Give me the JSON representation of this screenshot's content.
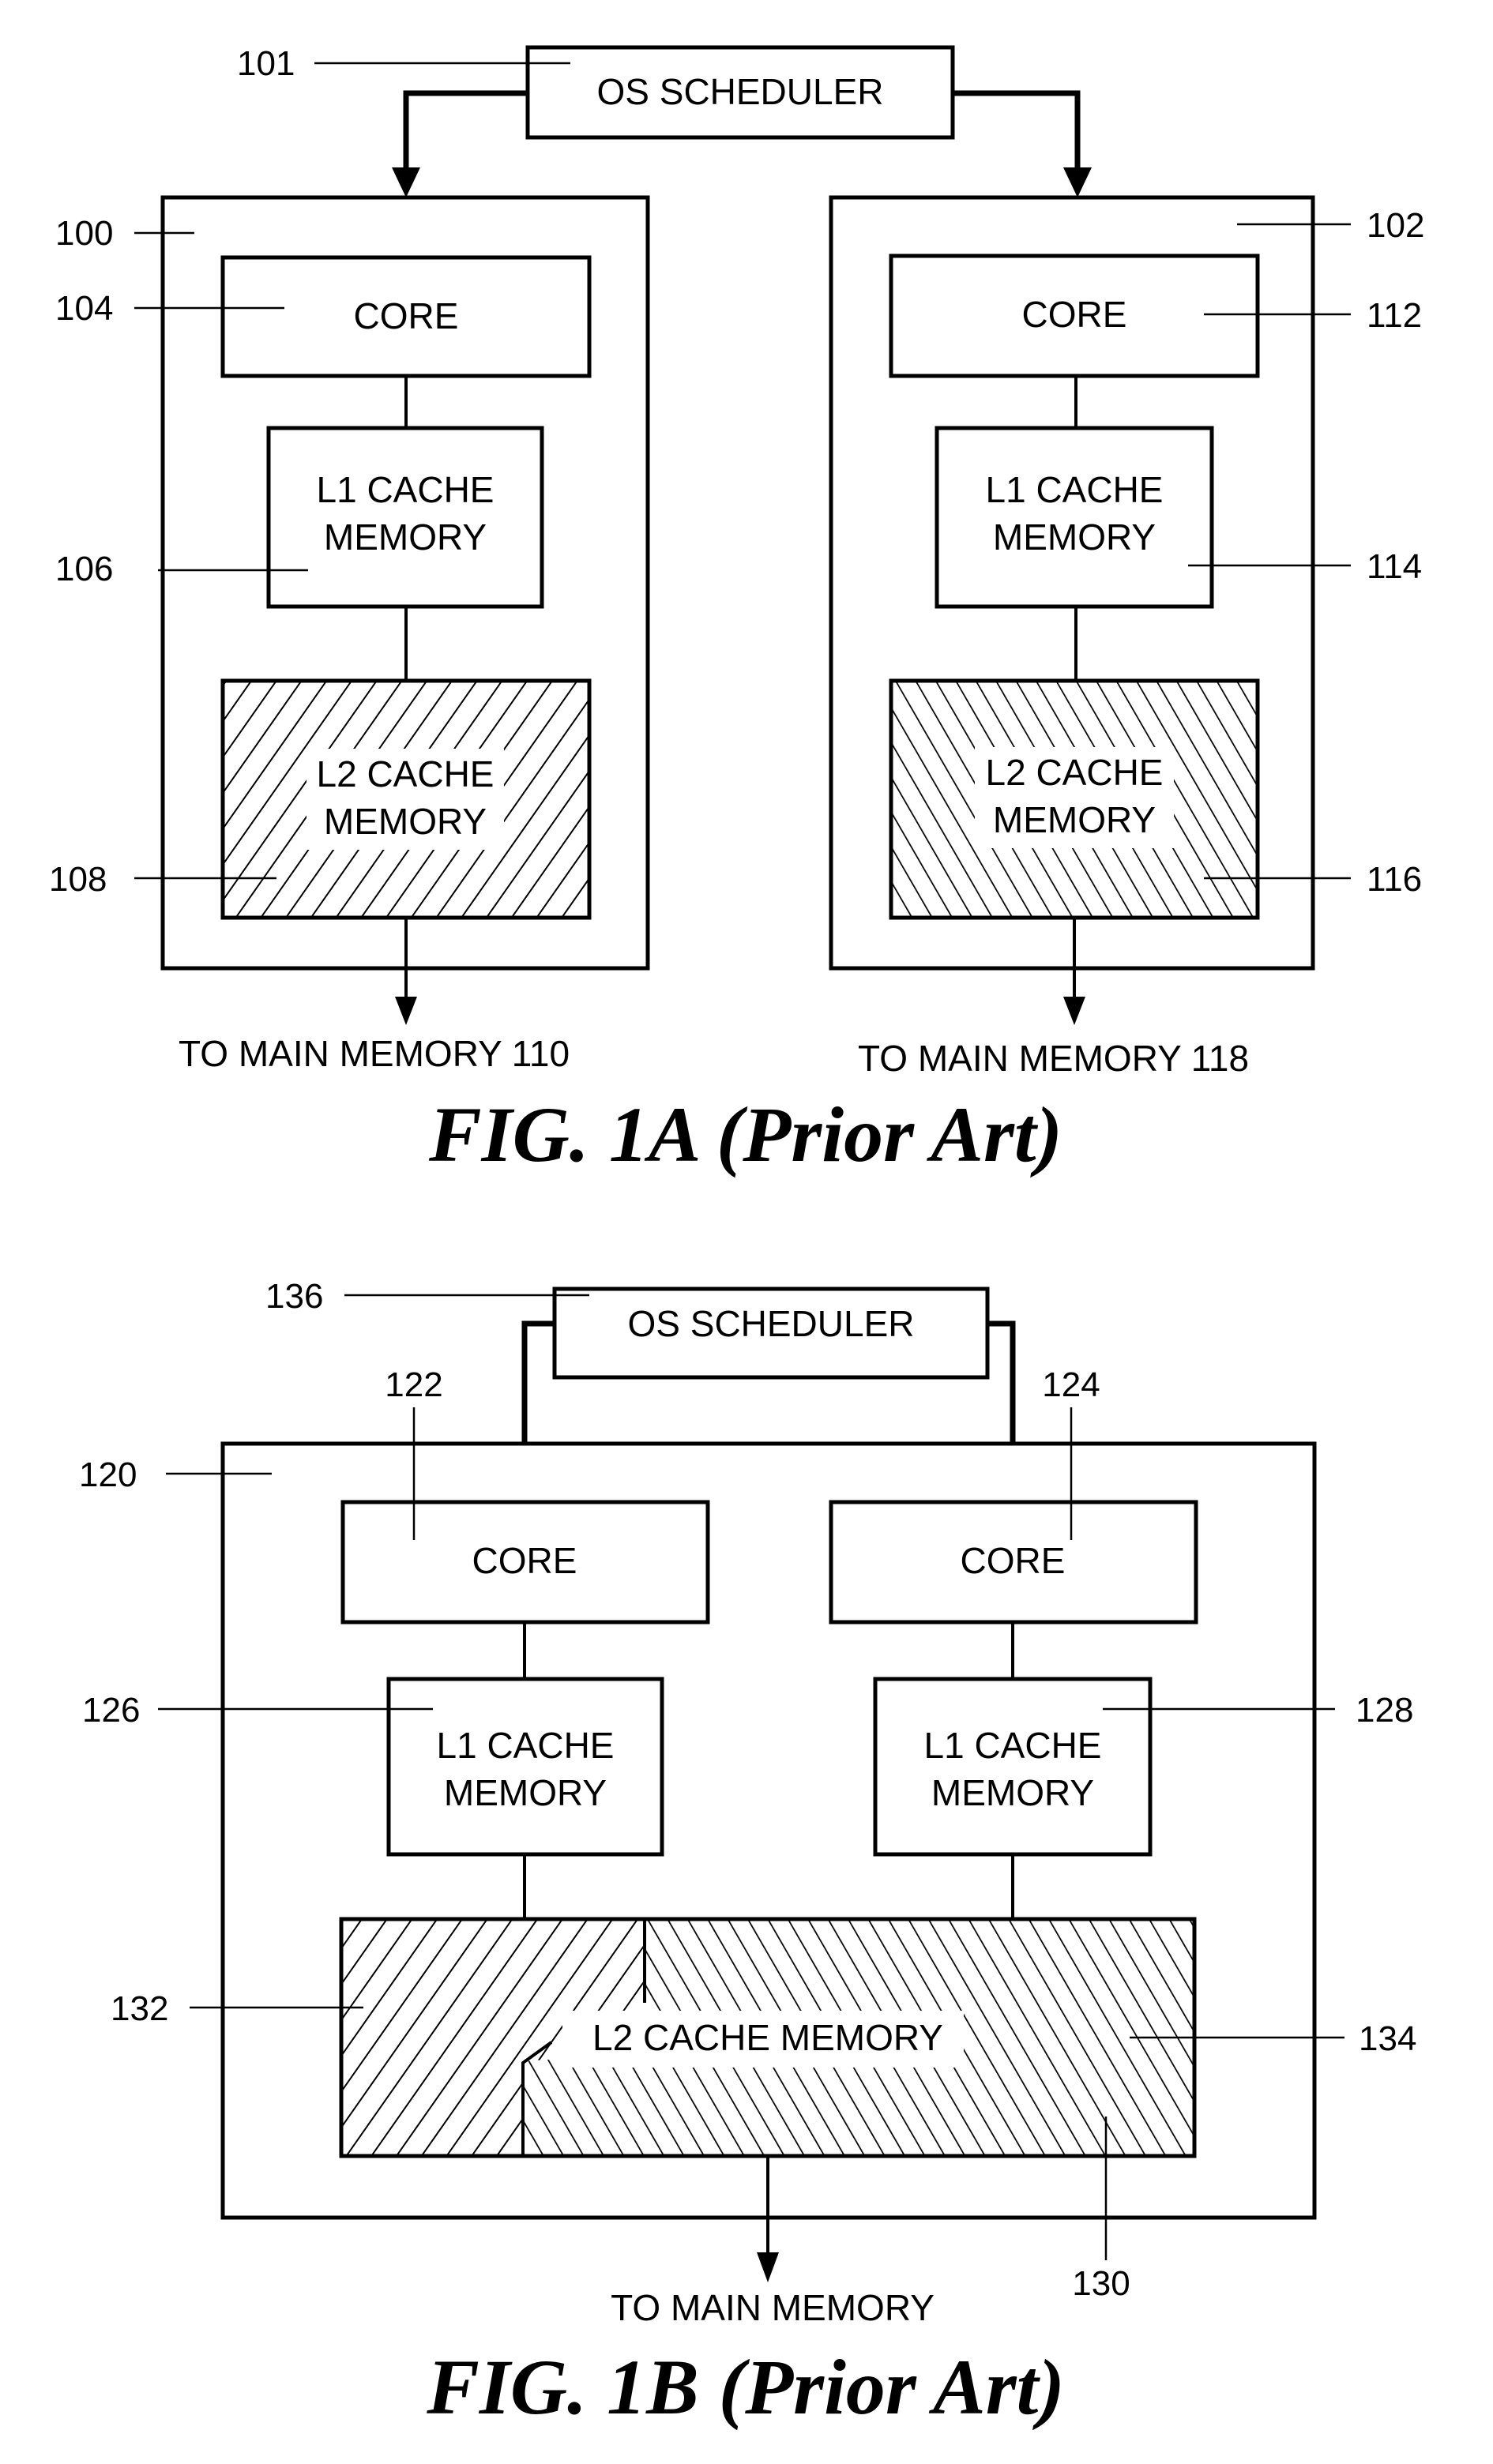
{
  "fig1a": {
    "caption": "FIG. 1A (Prior Art)",
    "scheduler": {
      "label": "OS SCHEDULER",
      "ref": "101"
    },
    "processors": [
      {
        "ref": "100",
        "core": {
          "label": "CORE",
          "ref": "104"
        },
        "l1": {
          "line1": "L1 CACHE",
          "line2": "MEMORY",
          "ref": "106"
        },
        "l2": {
          "line1": "L2 CACHE",
          "line2": "MEMORY",
          "ref": "108",
          "hatch": "forward"
        },
        "main_memory": "TO MAIN MEMORY 110"
      },
      {
        "ref": "102",
        "core": {
          "label": "CORE",
          "ref": "112"
        },
        "l1": {
          "line1": "L1 CACHE",
          "line2": "MEMORY",
          "ref": "114"
        },
        "l2": {
          "line1": "L2 CACHE",
          "line2": "MEMORY",
          "ref": "116",
          "hatch": "backward"
        },
        "main_memory": "TO MAIN MEMORY 118"
      }
    ]
  },
  "fig1b": {
    "caption": "FIG. 1B (Prior Art)",
    "scheduler": {
      "label": "OS SCHEDULER",
      "ref": "136"
    },
    "chip_ref": "120",
    "cores": [
      {
        "label": "CORE",
        "ref": "122"
      },
      {
        "label": "CORE",
        "ref": "124"
      }
    ],
    "l1": [
      {
        "line1": "L1 CACHE",
        "line2": "MEMORY",
        "ref": "126"
      },
      {
        "line1": "L1 CACHE",
        "line2": "MEMORY",
        "ref": "128"
      }
    ],
    "l2": {
      "label": "L2 CACHE MEMORY",
      "ref": "130",
      "partition_left_ref": "132",
      "partition_right_ref": "134"
    },
    "main_memory": "TO MAIN MEMORY"
  }
}
